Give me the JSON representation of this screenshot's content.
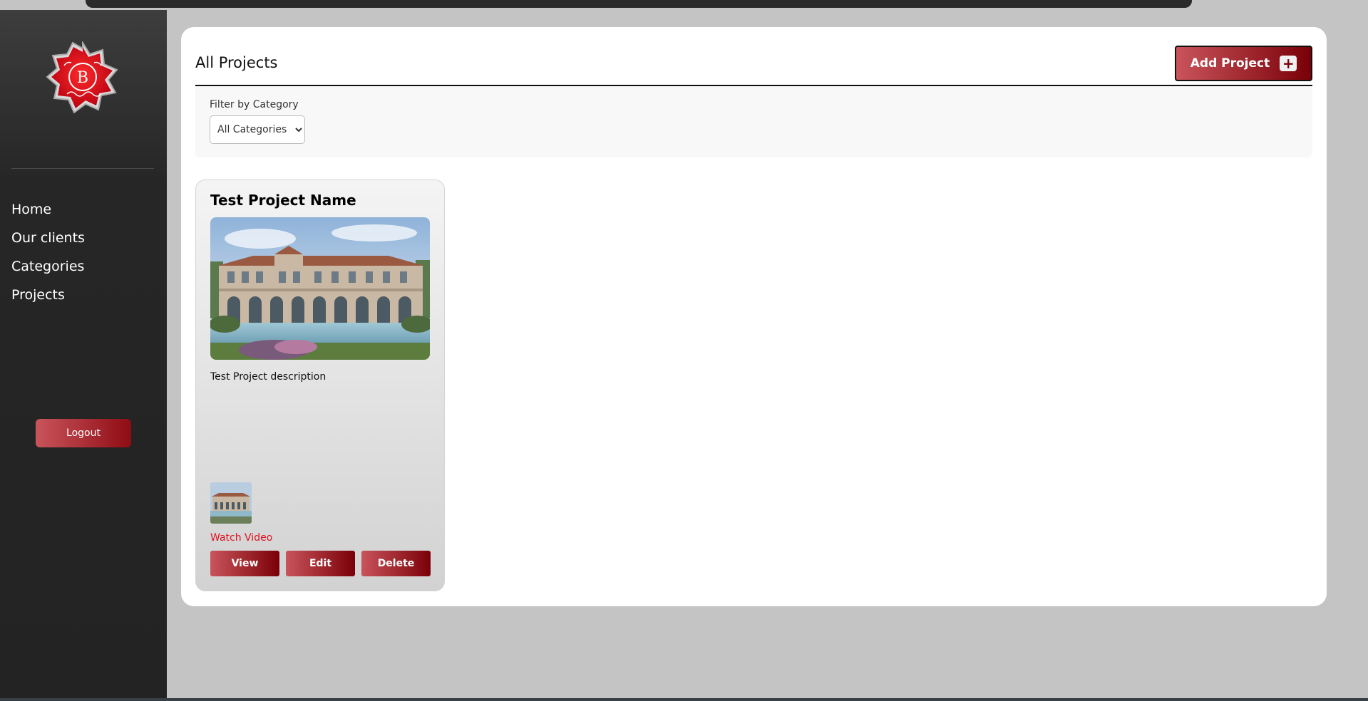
{
  "sidebar": {
    "nav_items": [
      {
        "label": "Home"
      },
      {
        "label": "Our clients"
      },
      {
        "label": "Categories"
      },
      {
        "label": "Projects"
      }
    ],
    "logout_label": "Logout",
    "logo_letter": "B"
  },
  "header": {
    "title": "All Projects",
    "add_project_label": "Add Project",
    "add_icon": "+"
  },
  "filter": {
    "label": "Filter by Category",
    "selected": "All Categories"
  },
  "projects": [
    {
      "name": "Test Project Name",
      "description": "Test Project description",
      "watch_video_label": "Watch Video",
      "view_label": "View",
      "edit_label": "Edit",
      "delete_label": "Delete"
    }
  ],
  "colors": {
    "accent_start": "#c9545b",
    "accent_end": "#7a0008",
    "link": "#e0101e",
    "sidebar_bg": "#232323",
    "page_bg": "#c4c4c4"
  }
}
